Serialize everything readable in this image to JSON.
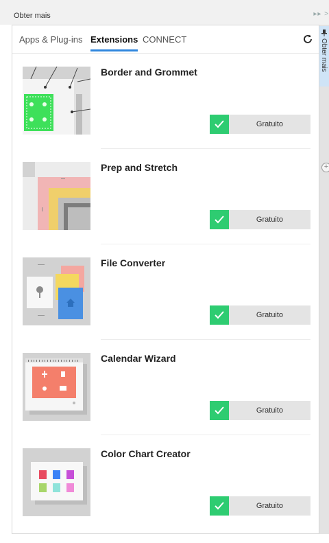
{
  "window": {
    "title": "Obter mais",
    "collapse_glyph": "▸▸ >"
  },
  "sidepanel": {
    "label": "Obter mais",
    "pin_icon": "pin-icon",
    "add_icon": "plus-circle-icon",
    "add_glyph": "+"
  },
  "tabs": [
    {
      "label": "Apps & Plug-ins",
      "active": false
    },
    {
      "label": "Extensions",
      "active": true
    },
    {
      "label": "CONNECT",
      "active": false
    }
  ],
  "refresh_icon": "refresh-icon",
  "items": [
    {
      "title": "Border and Grommet",
      "price": "Gratuito"
    },
    {
      "title": "Prep and Stretch",
      "price": "Gratuito"
    },
    {
      "title": "File Converter",
      "price": "Gratuito"
    },
    {
      "title": "Calendar Wizard",
      "price": "Gratuito"
    },
    {
      "title": "Color Chart Creator",
      "price": "Gratuito"
    }
  ],
  "colors": {
    "accent": "#2e86de",
    "check_green": "#2ecc71",
    "button_bg": "#e4e4e4"
  }
}
